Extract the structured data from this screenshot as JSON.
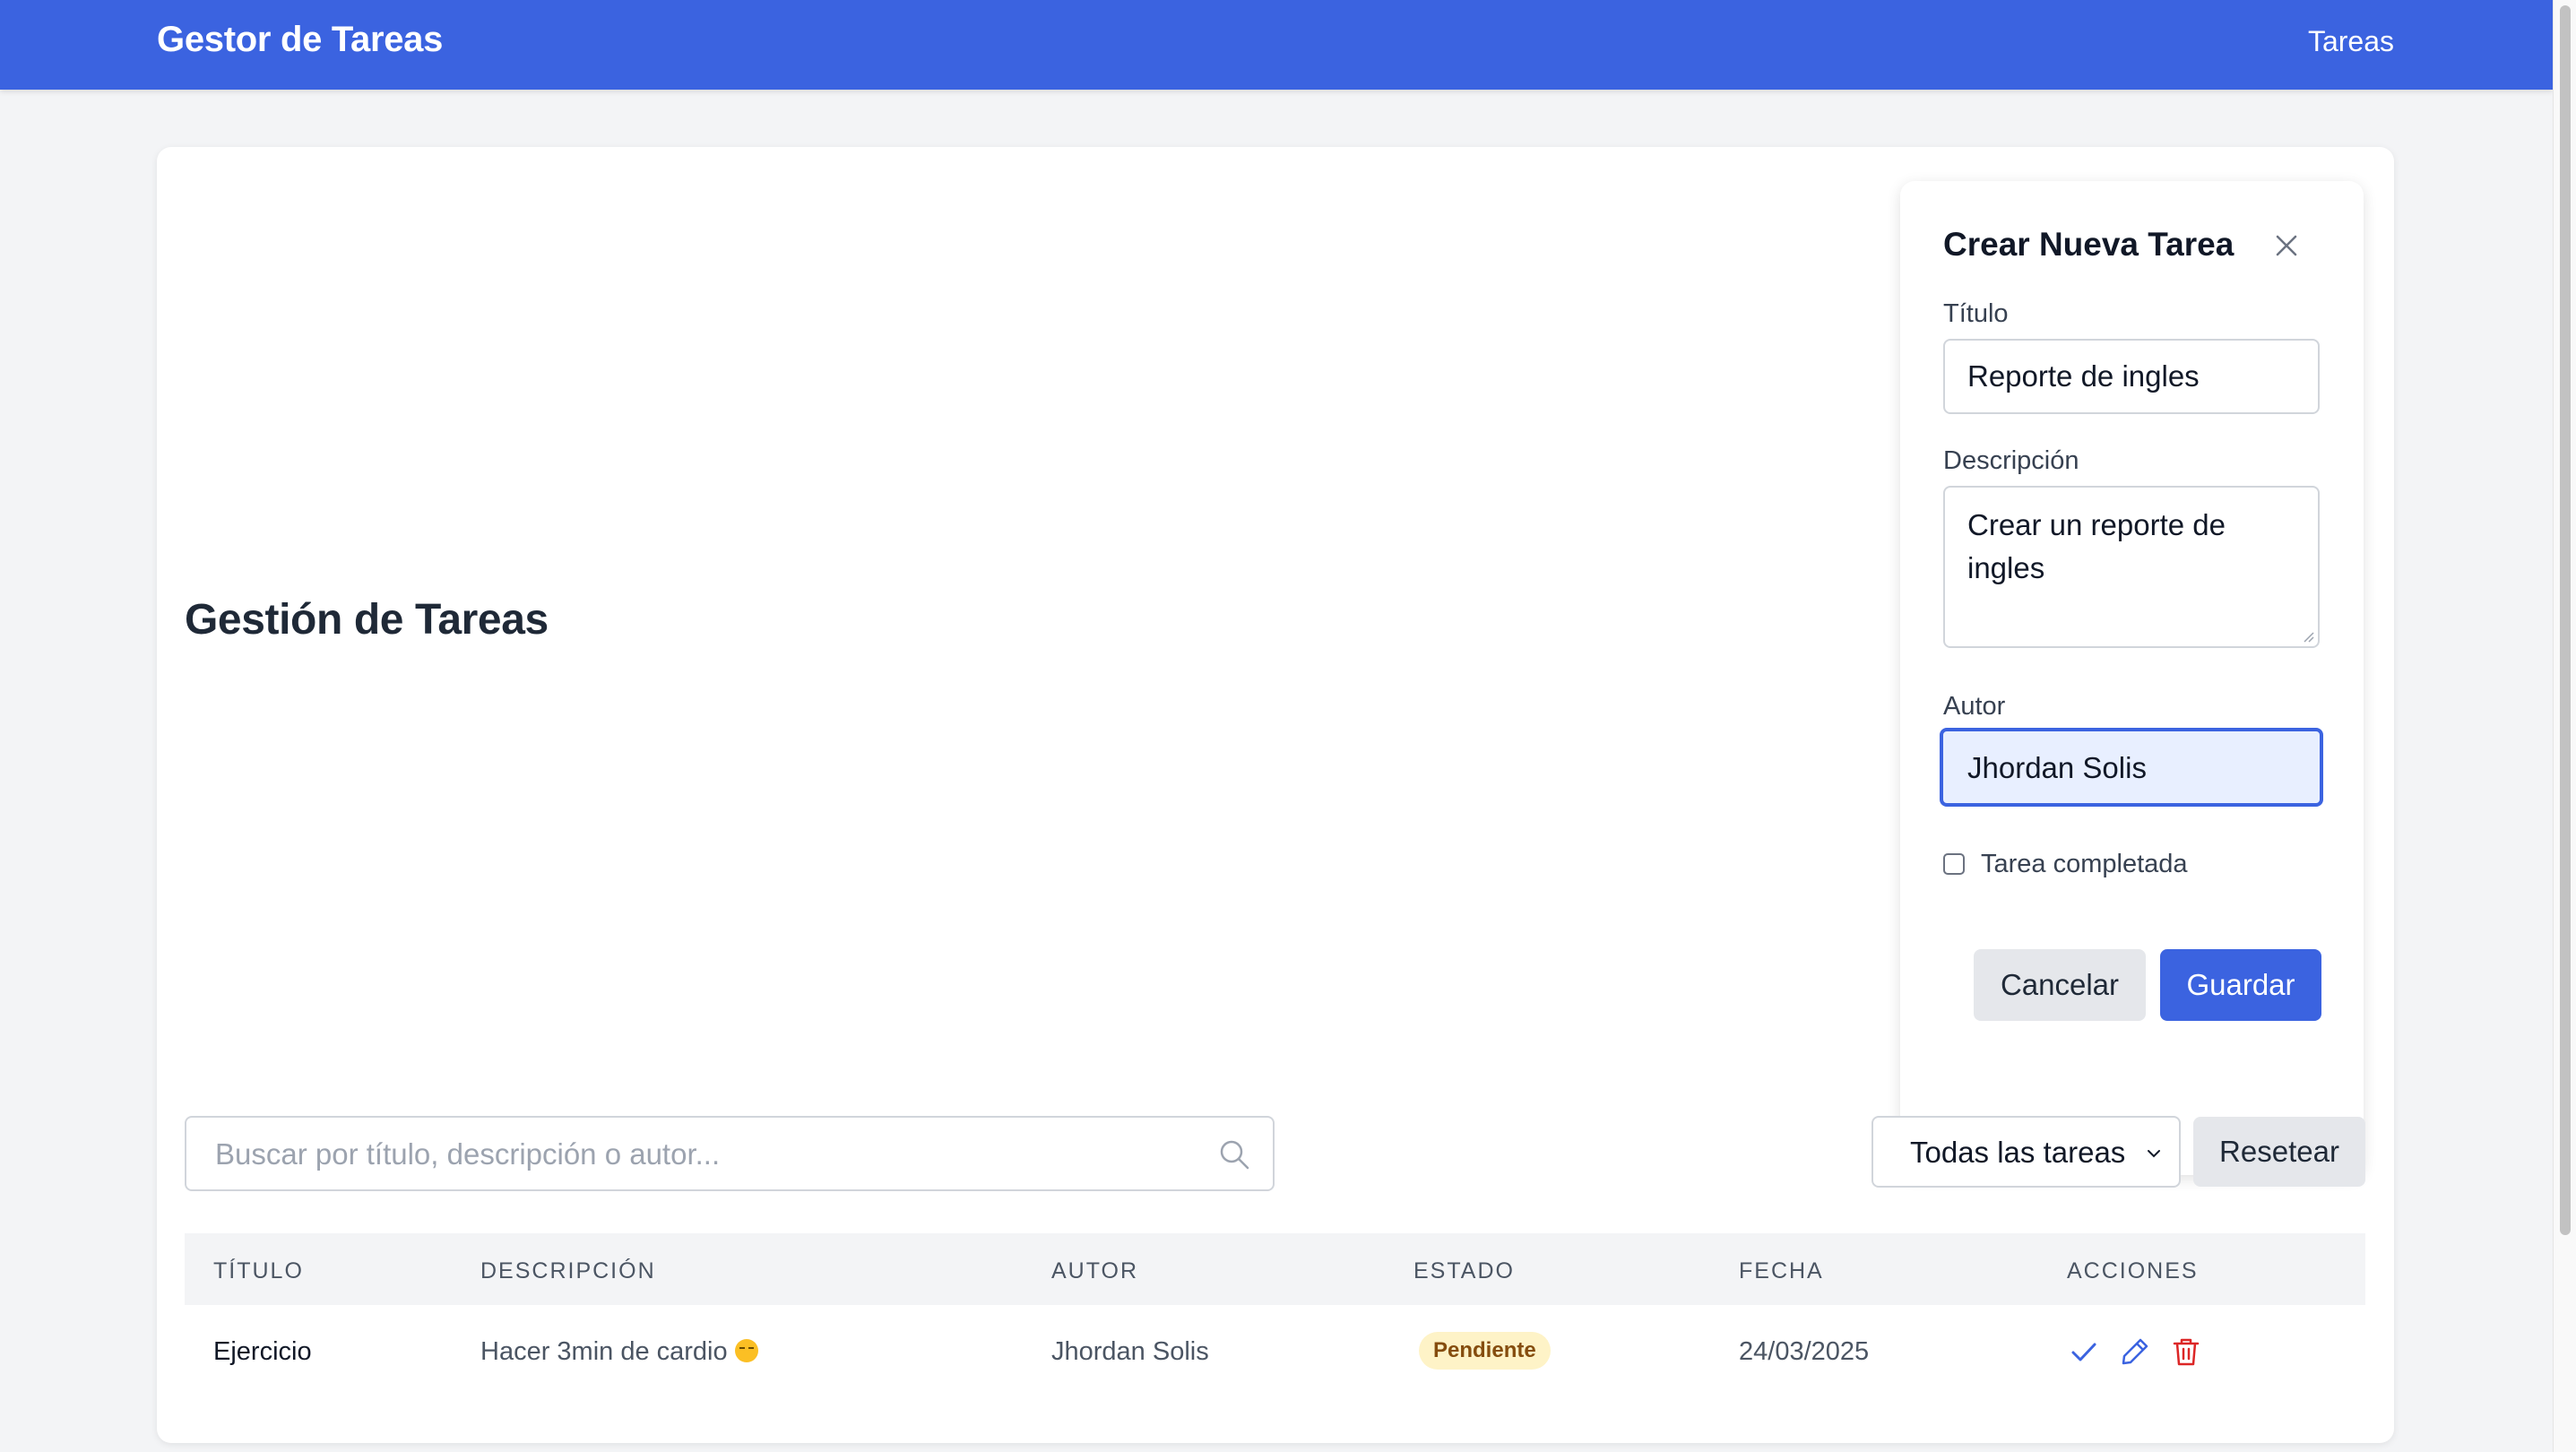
{
  "navbar": {
    "brand": "Gestor de Tareas",
    "link": "Tareas",
    "color": "#3b63e0"
  },
  "page": {
    "title": "Gestión de Tareas"
  },
  "form": {
    "title": "Crear Nueva Tarea",
    "close_icon": "close-icon",
    "title_label": "Título",
    "title_value": "Reporte de ingles",
    "description_label": "Descripción",
    "description_value": "Crear un reporte de ingles",
    "author_label": "Autor",
    "author_value": "Jhordan Solis",
    "completed_label": "Tarea completada",
    "completed_checked": false,
    "cancel_label": "Cancelar",
    "save_label": "Guardar"
  },
  "filters": {
    "search_placeholder": "Buscar por título, descripción o autor...",
    "search_icon": "search-icon",
    "select_value": "Todas las tareas",
    "reset_label": "Resetear"
  },
  "table": {
    "headers": [
      "TÍTULO",
      "DESCRIPCIÓN",
      "AUTOR",
      "ESTADO",
      "FECHA",
      "ACCIONES"
    ],
    "rows": [
      {
        "title": "Ejercicio",
        "description": "Hacer 3min de cardio",
        "description_emoji": "smiling-face-emoji",
        "author": "Jhordan Solis",
        "status": "Pendiente",
        "date": "24/03/2025",
        "actions": [
          "check-icon",
          "pencil-icon",
          "trash-icon"
        ]
      }
    ]
  },
  "colors": {
    "accent": "#3b63e0",
    "badge_bg": "#fef3c7",
    "badge_text": "#854d0e",
    "delete": "#dc2626"
  }
}
